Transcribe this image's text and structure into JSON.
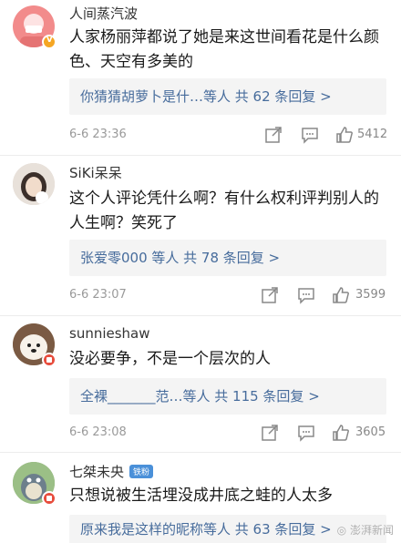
{
  "comments": [
    {
      "username": "人间蒸汽波",
      "text": "人家杨丽萍都说了她是来这世间看花是什么颜色、天空有多美的",
      "replies": "你猜猜胡萝卜是什…等人  共 62 条回复 >",
      "time": "6-6 23:36",
      "likes": "5412",
      "avatar_color": "#f28b8b",
      "badge": "verified-v"
    },
    {
      "username": "SiKi呆呆",
      "text": "这个人评论凭什么啊？有什么权利评判别人的人生啊？笑死了",
      "replies": "张爱零000 等人  共 78 条回复 >",
      "time": "6-6 23:07",
      "likes": "3599",
      "avatar_color": "#d9cfc7",
      "badge": ""
    },
    {
      "username": "sunnieshaw",
      "text": "没必要争，不是一个层次的人",
      "replies": "全裸_______范…等人  共 115 条回复 >",
      "time": "6-6 23:08",
      "likes": "3605",
      "avatar_color": "#c8a98b",
      "badge": "red-badge"
    },
    {
      "username": "七桀未央",
      "tag": "铁粉",
      "text": "只想说被生活埋没成井底之蛙的人太多",
      "replies": "原来我是这样的昵称等人  共 63 条回复 >",
      "avatar_color": "#8ba87a",
      "badge": "red-badge"
    }
  ],
  "watermark": "澎湃新闻",
  "colors": {
    "link": "#476c9c",
    "reply_bg": "#f4f4f4",
    "meta": "#9a9a9a"
  }
}
